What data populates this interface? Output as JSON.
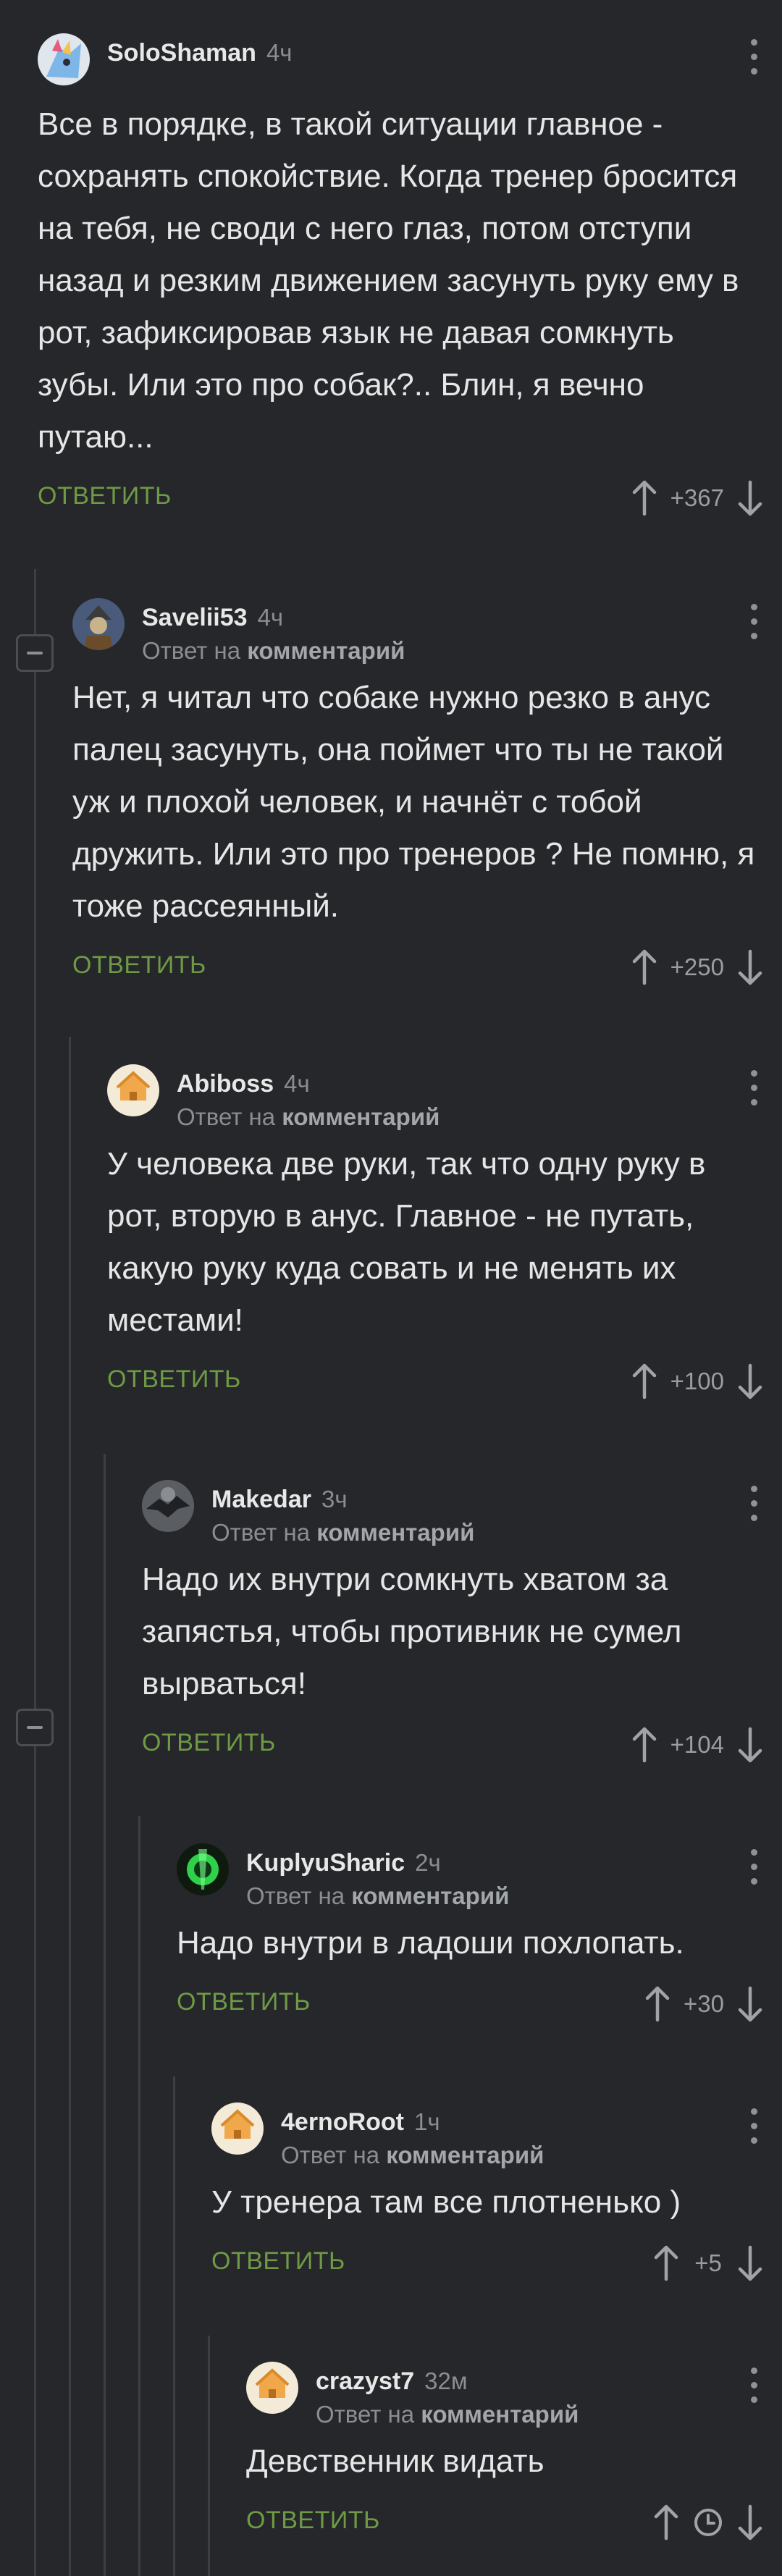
{
  "reply_to_prefix": "Ответ на",
  "reply_to_target": "комментарий",
  "reply_label": "ОТВЕТИТЬ",
  "comments": [
    {
      "user": "SoloShaman",
      "time": "4ч",
      "text": "Все в порядке, в такой ситуации главное - сохранять спокойствие. Когда тренер бросится на тебя,  не своди с него глаз, потом отступи назад и резким движением засунуть руку ему в рот, зафиксировав язык не давая сомкнуть зубы. Или это про собак?.. Блин, я вечно путаю...",
      "score": "+367"
    },
    {
      "user": "Savelii53",
      "time": "4ч",
      "text": "Нет, я читал что собаке нужно резко в анус палец засунуть, она поймет что ты не такой уж и плохой человек, и начнёт с тобой дружить. Или это про тренеров ? Не помню, я тоже рассеянный.",
      "score": "+250"
    },
    {
      "user": "Abiboss",
      "time": "4ч",
      "text": "У человека две руки, так что одну руку в рот, вторую в анус. Главное - не путать, какую руку куда совать и не менять их местами!",
      "score": "+100"
    },
    {
      "user": "Makedar",
      "time": "3ч",
      "text": "Надо их внутри сомкнуть хватом за запястья, чтобы противник не сумел вырваться!",
      "score": "+104"
    },
    {
      "user": "KuplyuSharic",
      "time": "2ч",
      "text": "Надо внутри в ладоши похлопать.",
      "score": "+30"
    },
    {
      "user": "4ernoRoot",
      "time": "1ч",
      "text": "У тренера там все плотненько )",
      "score": "+5"
    },
    {
      "user": "crazyst7",
      "time": "32м",
      "text": "Девственник видать",
      "score": ""
    }
  ]
}
